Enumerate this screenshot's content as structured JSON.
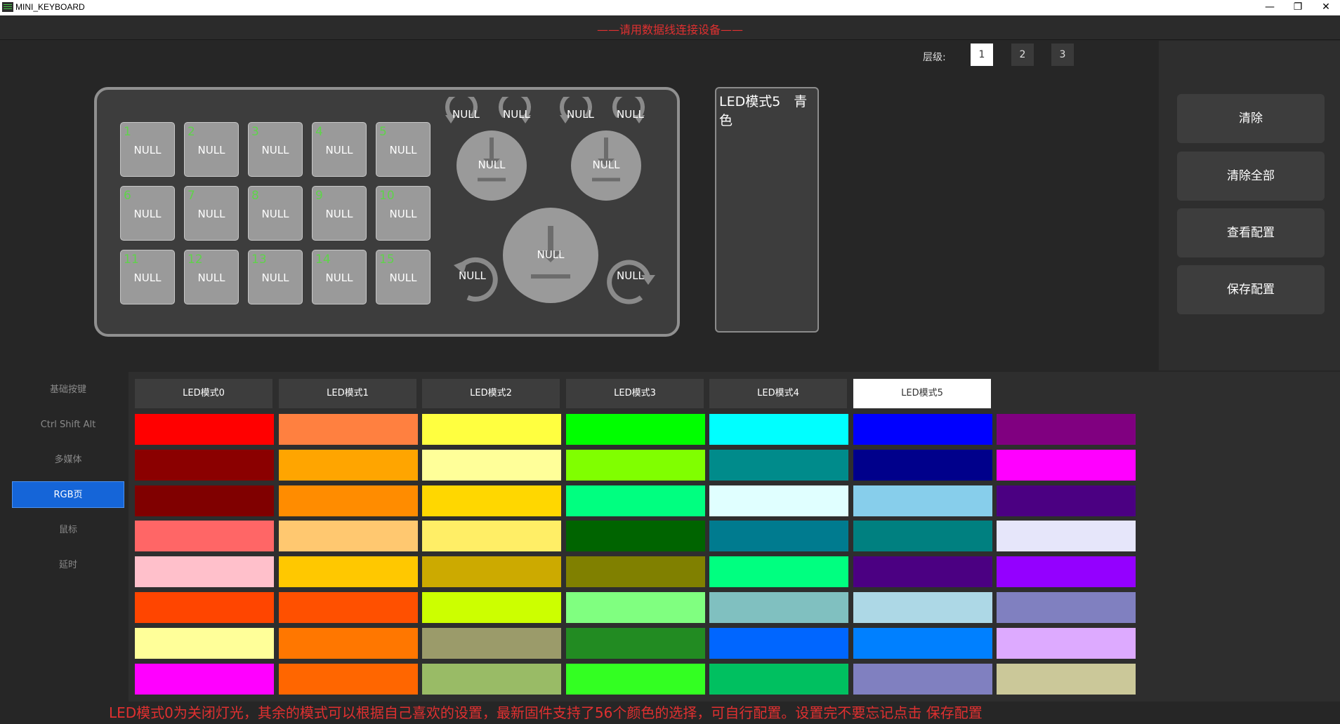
{
  "window": {
    "title": "MINI_KEYBOARD",
    "min": "—",
    "restore": "❐",
    "close": "✕"
  },
  "status": {
    "text": "——请用数据线连接设备——"
  },
  "layers": {
    "label": "层级:",
    "items": [
      "1",
      "2",
      "3"
    ],
    "active": 0
  },
  "keys": [
    {
      "num": "1",
      "label": "NULL"
    },
    {
      "num": "2",
      "label": "NULL"
    },
    {
      "num": "3",
      "label": "NULL"
    },
    {
      "num": "4",
      "label": "NULL"
    },
    {
      "num": "5",
      "label": "NULL"
    },
    {
      "num": "6",
      "label": "NULL"
    },
    {
      "num": "7",
      "label": "NULL"
    },
    {
      "num": "8",
      "label": "NULL"
    },
    {
      "num": "9",
      "label": "NULL"
    },
    {
      "num": "10",
      "label": "NULL"
    },
    {
      "num": "11",
      "label": "NULL"
    },
    {
      "num": "12",
      "label": "NULL"
    },
    {
      "num": "13",
      "label": "NULL"
    },
    {
      "num": "14",
      "label": "NULL"
    },
    {
      "num": "15",
      "label": "NULL"
    }
  ],
  "knobs": {
    "small1": {
      "press": "NULL",
      "ccw": "NULL",
      "cw": "NULL"
    },
    "small2": {
      "press": "NULL",
      "ccw": "NULL",
      "cw": "NULL"
    },
    "big": {
      "press": "NULL",
      "ccw": "NULL",
      "cw": "NULL"
    }
  },
  "led_info": {
    "text": "LED模式5　青色"
  },
  "actions": {
    "clear": "清除",
    "clear_all": "清除全部",
    "view_config": "查看配置",
    "save_config": "保存配置"
  },
  "nav": {
    "items": [
      "基础按键",
      "Ctrl Shift Alt",
      "多媒体",
      "RGB页",
      "鼠标",
      "延时"
    ],
    "active": 3
  },
  "led_modes": {
    "items": [
      "LED模式0",
      "LED模式1",
      "LED模式2",
      "LED模式3",
      "LED模式4",
      "LED模式5"
    ],
    "active": 5
  },
  "palette": [
    [
      "#ff0000",
      "#ff8040",
      "#ffff40",
      "#00ff00",
      "#00ffff",
      "#0000ff",
      "#800080"
    ],
    [
      "#8b0000",
      "#ffa500",
      "#ffff99",
      "#80ff00",
      "#008b8b",
      "#00008b",
      "#ff00ff"
    ],
    [
      "#800000",
      "#ff8c00",
      "#ffd700",
      "#00ff80",
      "#e0ffff",
      "#87ceeb",
      "#4b0082"
    ],
    [
      "#ff6666",
      "#ffc870",
      "#ffee66",
      "#006400",
      "#007b8f",
      "#008080",
      "#e6e6fa"
    ],
    [
      "#ffc0cb",
      "#ffc800",
      "#ccaa00",
      "#808000",
      "#00ff80",
      "#4b0082",
      "#9400ff"
    ],
    [
      "#ff4500",
      "#ff5000",
      "#ccff00",
      "#80ff80",
      "#80c0c0",
      "#add8e6",
      "#8080c0"
    ],
    [
      "#ffff99",
      "#ff7700",
      "#9b9b6a",
      "#228b22",
      "#0066ff",
      "#0080ff",
      "#ddaaff"
    ],
    [
      "#ff00ff",
      "#ff6600",
      "#99bb66",
      "#33ff22",
      "#00c060",
      "#8080c0",
      "#cbc899"
    ]
  ],
  "footer": {
    "note": "LED模式0为关闭灯光，其余的模式可以根据自己喜欢的设置，最新固件支持了56个颜色的选择，可自行配置。设置完不要忘记点击 保存配置"
  }
}
